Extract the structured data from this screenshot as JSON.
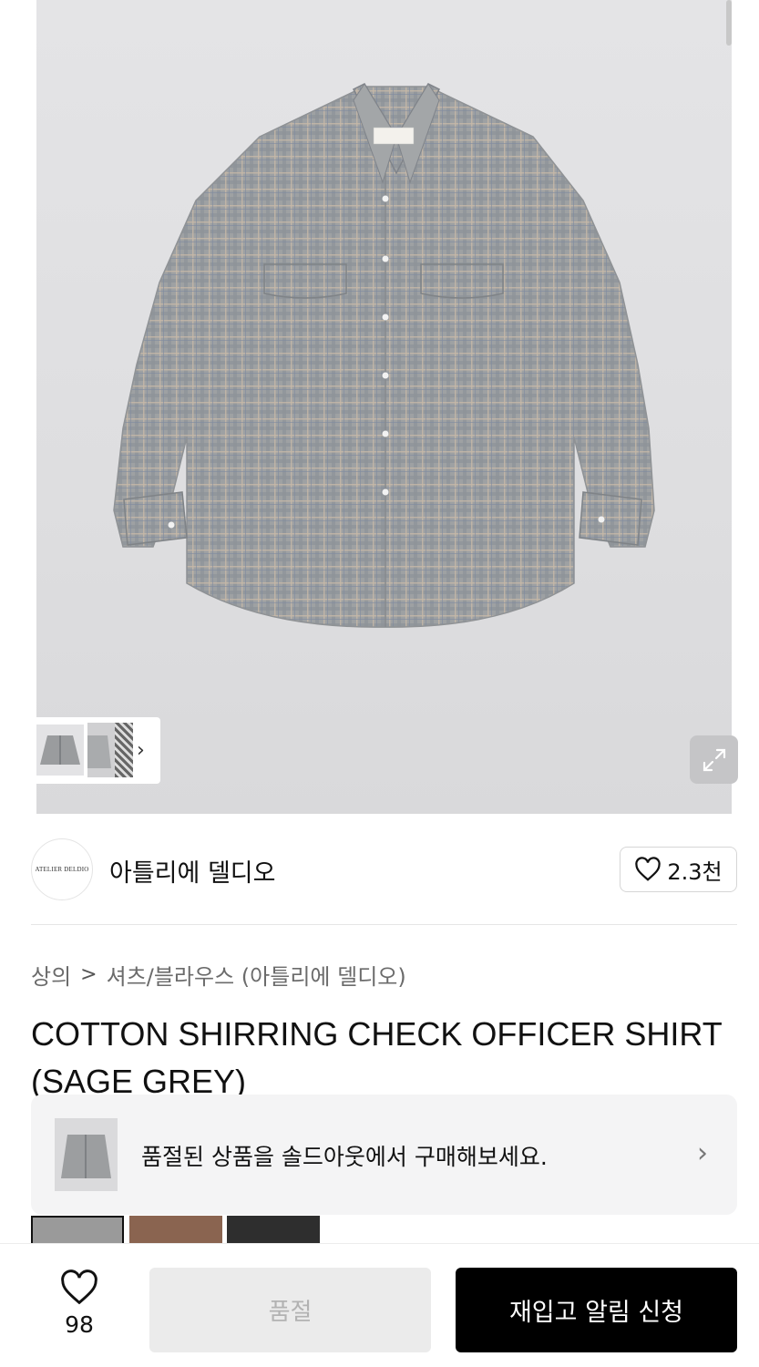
{
  "gallery": {
    "image_label": "shirt-product-photo",
    "thumb_next_icon": "chevron-right-icon",
    "expand_icon": "expand-icon"
  },
  "brand": {
    "logo_text": "ATELIER DELDIO",
    "name": "아틀리에 델디오",
    "like_icon": "heart-outline-icon",
    "like_count": "2.3천"
  },
  "breadcrumb": {
    "category": "상의",
    "separator": ">",
    "subcategory": "셔츠/블라우스 (아틀리에 델디오)"
  },
  "product": {
    "title": "COTTON SHIRRING CHECK OFFICER SHIRT (SAGE GREY)"
  },
  "soldout_banner": {
    "text": "품절된 상품을 솔드아웃에서 구매해보세요.",
    "arrow": "›"
  },
  "color_options": {
    "swatch_colors": [
      "#9a9a9a",
      "#8a6450",
      "#2e2e2e"
    ]
  },
  "bottom_bar": {
    "wish_icon": "heart-outline-icon",
    "wish_count": "98",
    "soldout_label": "품절",
    "restock_label": "재입고 알림 신청"
  },
  "colors": {
    "primary_button": "#000000",
    "disabled_button": "#ebebeb",
    "banner_bg": "#f4f4f5"
  }
}
